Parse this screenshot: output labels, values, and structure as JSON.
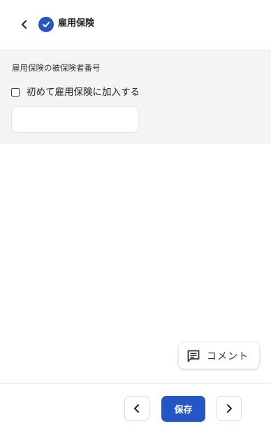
{
  "header": {
    "title": "雇用保険",
    "back_icon": "chevron-left-icon",
    "status_icon": "check-circle-icon"
  },
  "form": {
    "field_label": "雇用保険の被保険者番号",
    "checkbox_label": "初めて雇用保険に加入する",
    "checkbox_checked": false,
    "input_value": "",
    "input_placeholder": ""
  },
  "comment": {
    "label": "コメント",
    "icon": "comment-icon"
  },
  "footer": {
    "prev_icon": "chevron-left-icon",
    "save_label": "保存",
    "next_icon": "chevron-right-icon"
  },
  "colors": {
    "accent": "#2456c6",
    "section_bg": "#f5f4f3"
  }
}
